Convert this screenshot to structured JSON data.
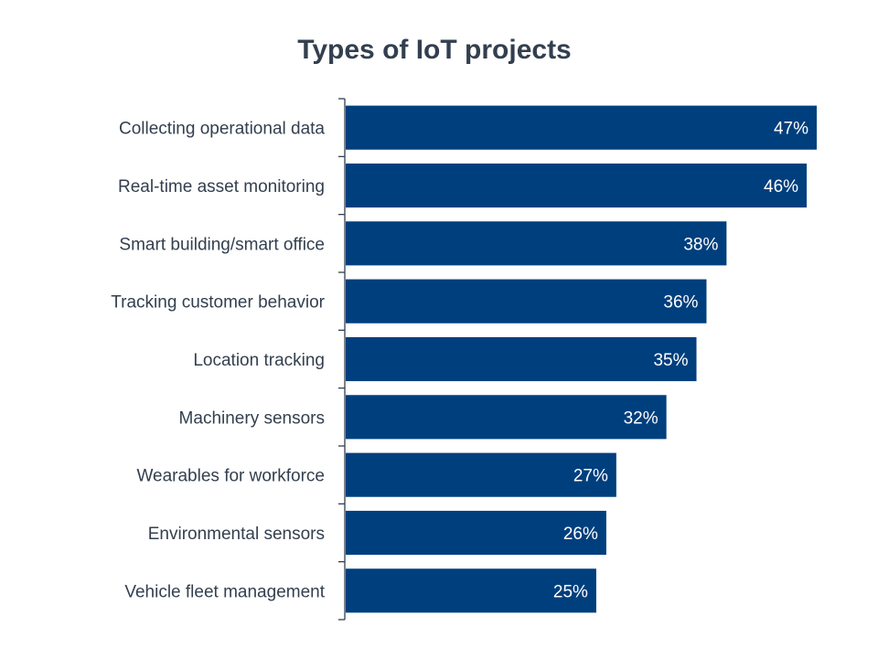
{
  "chart_data": {
    "type": "bar",
    "orientation": "horizontal",
    "title": "Types of IoT projects",
    "xlabel": "",
    "ylabel": "",
    "categories": [
      "Collecting operational data",
      "Real-time asset monitoring",
      "Smart building/smart office",
      "Tracking customer behavior",
      "Location tracking",
      "Machinery sensors",
      "Wearables for workforce",
      "Environmental sensors",
      "Vehicle fleet management"
    ],
    "values": [
      47,
      46,
      38,
      36,
      35,
      32,
      27,
      26,
      25
    ],
    "data_labels": [
      "47%",
      "46%",
      "38%",
      "36%",
      "35%",
      "32%",
      "27%",
      "26%",
      "25%"
    ],
    "unit": "%",
    "xlim": [
      0,
      47
    ],
    "grid": false,
    "legend": "none",
    "bar_color": "#003f7d"
  }
}
